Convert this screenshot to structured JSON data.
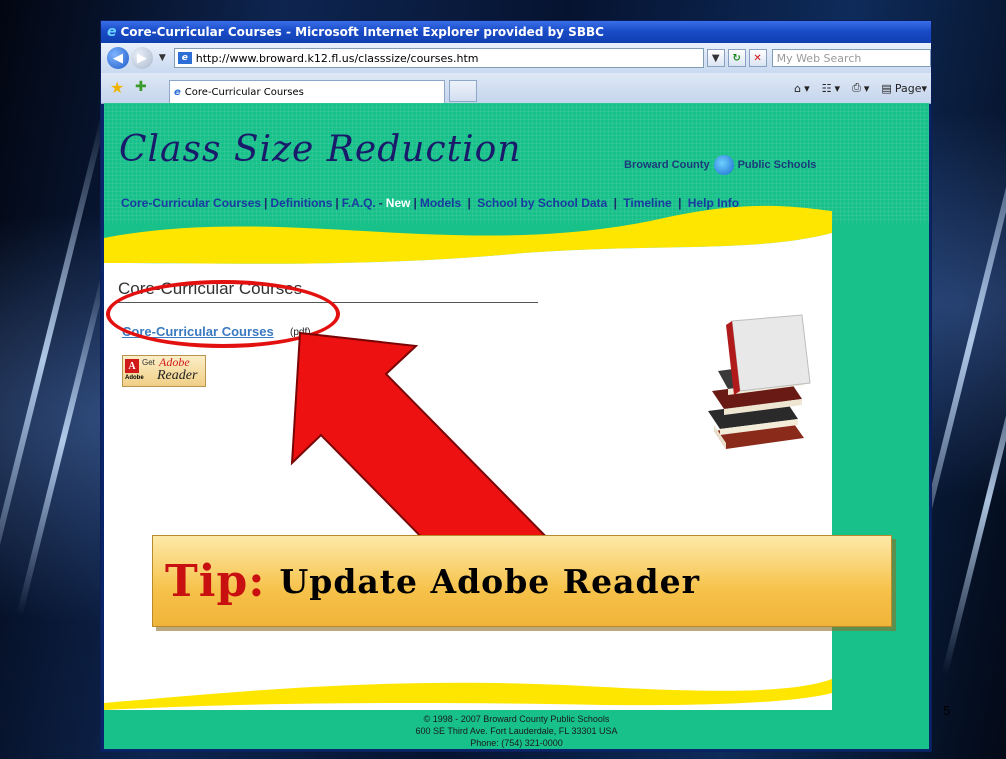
{
  "window": {
    "title": "Core-Curricular Courses - Microsoft Internet Explorer provided by SBBC"
  },
  "addressbar": {
    "url": "http://www.broward.k12.fl.us/classsize/courses.htm",
    "search_placeholder": "My Web Search"
  },
  "tabbar": {
    "tab_title": "Core-Curricular Courses",
    "page_label": "Page"
  },
  "site": {
    "title": "Class Size Reduction",
    "district_left": "Broward County",
    "district_right": "Public Schools",
    "nav": [
      {
        "label": "Core-Curricular Courses"
      },
      {
        "label": "Definitions"
      },
      {
        "label": "F.A.Q."
      },
      {
        "label": "New"
      },
      {
        "label": "Models"
      },
      {
        "label": "School by School Data"
      },
      {
        "label": "Timeline"
      },
      {
        "label": "Help Info"
      }
    ]
  },
  "main": {
    "heading": "Core-Curricular Courses",
    "pdf_link": "Core-Curricular Courses",
    "pdf_tag": "(pdf)",
    "adobe_get": "Get",
    "adobe_adobe": "Adobe",
    "adobe_reader": "Reader",
    "adobe_sub": "Adobe"
  },
  "footer": {
    "line1": "© 1998 - 2007   Broward County Public Schools",
    "line2": "600 SE Third Ave. Fort Lauderdale, FL 33301 USA",
    "line3": "Phone: (754) 321-0000"
  },
  "overlay": {
    "tip_label": "Tip:",
    "tip_text": "Update Adobe Reader",
    "slide_number": "5"
  },
  "colors": {
    "page_green": "#18c08a",
    "callout_red": "#e31010",
    "tip_yellow": "#f6c24a",
    "site_title": "#1a1a6a"
  }
}
